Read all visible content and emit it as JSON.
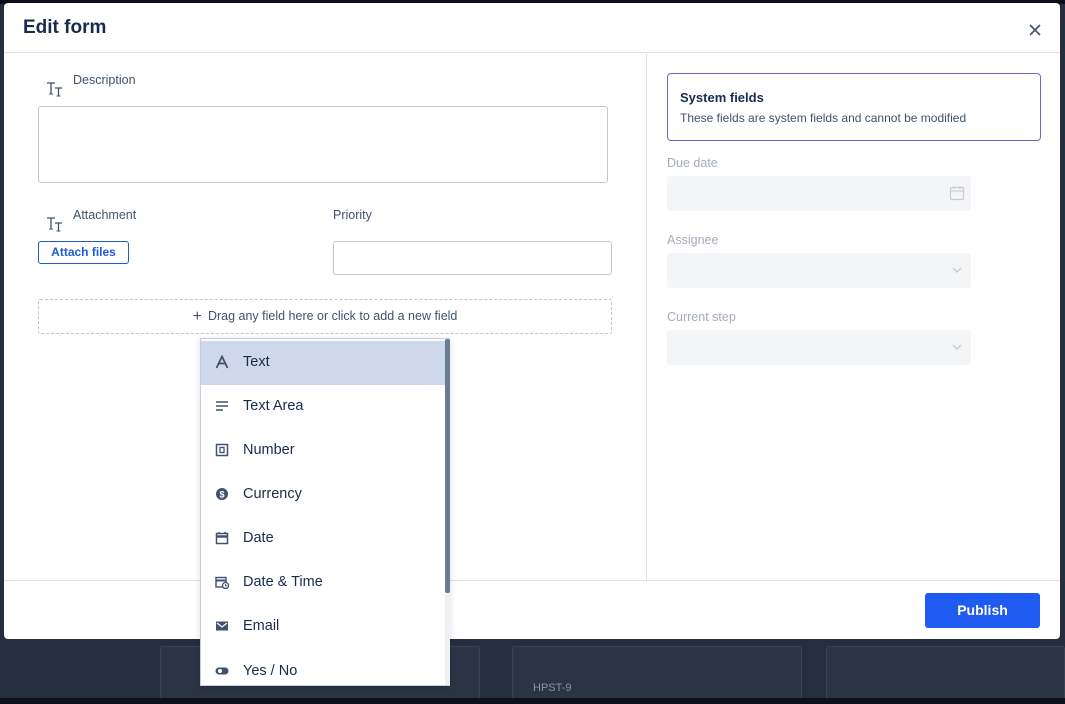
{
  "background": {
    "tag": "HPST-9"
  },
  "modal": {
    "title": "Edit form",
    "close_icon": "close-icon"
  },
  "form": {
    "description_label": "Description",
    "attachment_label": "Attachment",
    "attach_button": "Attach files",
    "priority_label": "Priority",
    "dropzone_text": "Drag any field here or click to add a new field"
  },
  "system_fields": {
    "title": "System fields",
    "subtitle": "These fields are system fields and cannot be modified",
    "due_date_label": "Due date",
    "assignee_label": "Assignee",
    "current_step_label": "Current step"
  },
  "field_menu": {
    "items": [
      {
        "label": "Text",
        "icon": "text-icon",
        "selected": true
      },
      {
        "label": "Text Area",
        "icon": "text-area-icon",
        "selected": false
      },
      {
        "label": "Number",
        "icon": "number-icon",
        "selected": false
      },
      {
        "label": "Currency",
        "icon": "currency-icon",
        "selected": false
      },
      {
        "label": "Date",
        "icon": "calendar-icon",
        "selected": false
      },
      {
        "label": "Date & Time",
        "icon": "date-time-icon",
        "selected": false
      },
      {
        "label": "Email",
        "icon": "email-icon",
        "selected": false
      },
      {
        "label": "Yes / No",
        "icon": "toggle-icon",
        "selected": false
      }
    ]
  },
  "footer": {
    "publish_button": "Publish"
  },
  "colors": {
    "primary": "#1f5bf0",
    "accent_border": "#7b61d6",
    "selected_item": "#cdd8ec"
  }
}
